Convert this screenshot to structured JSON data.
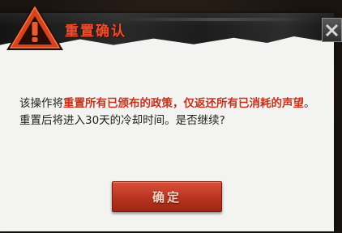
{
  "dialog": {
    "title": "重置确认",
    "message_prefix": "该操作将",
    "message_highlight": "重置所有已颁布的政策，仅返还所有已消耗的声望",
    "message_suffix": "。重置后将进入30天的冷却时间。是否继续?",
    "confirm_label": "确定",
    "close_icon": "close-icon",
    "warning_icon": "warning-icon"
  },
  "colors": {
    "accent": "#e8502f",
    "highlight_text": "#c4321c",
    "button": "#b8331f",
    "panel": "#f3f3f1"
  }
}
